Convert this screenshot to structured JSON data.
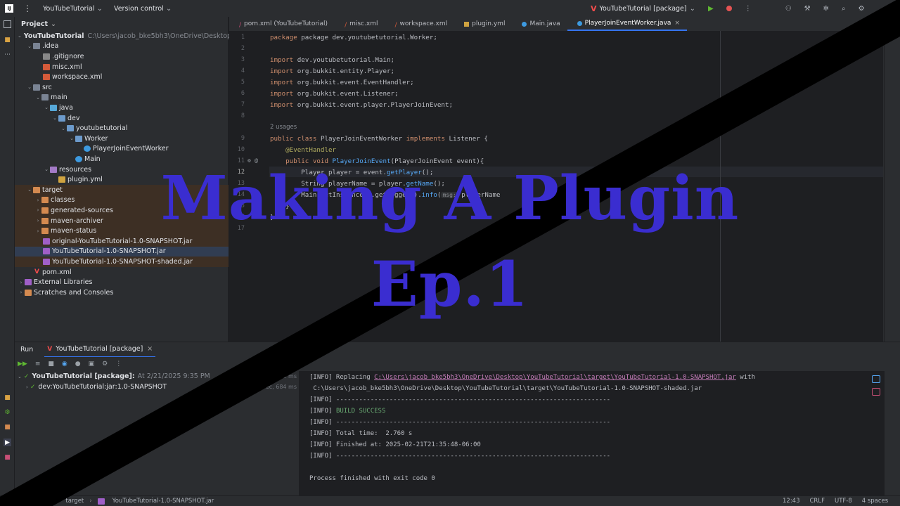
{
  "titlebar": {
    "project": "YouTubeTutorial",
    "version_control": "Version control",
    "run_config": "YouTubeTutorial [package]"
  },
  "project_panel": {
    "title": "Project"
  },
  "tree": [
    {
      "label": "YouTubeTutorial",
      "path": "C:\\Users\\jacob_bke5bh3\\OneDrive\\Desktop\\YouTubeTutorial"
    },
    {
      "label": ".idea"
    },
    {
      "label": ".gitignore"
    },
    {
      "label": "misc.xml"
    },
    {
      "label": "workspace.xml"
    },
    {
      "label": "src"
    },
    {
      "label": "main"
    },
    {
      "label": "java"
    },
    {
      "label": "dev"
    },
    {
      "label": "youtubetutorial"
    },
    {
      "label": "Worker"
    },
    {
      "label": "PlayerJoinEventWorker"
    },
    {
      "label": "Main"
    },
    {
      "label": "resources"
    },
    {
      "label": "plugin.yml"
    },
    {
      "label": "target"
    },
    {
      "label": "classes"
    },
    {
      "label": "generated-sources"
    },
    {
      "label": "maven-archiver"
    },
    {
      "label": "maven-status"
    },
    {
      "label": "original-YouTubeTutorial-1.0-SNAPSHOT.jar"
    },
    {
      "label": "YouTubeTutorial-1.0-SNAPSHOT.jar"
    },
    {
      "label": "YouTubeTutorial-1.0-SNAPSHOT-shaded.jar"
    },
    {
      "label": "pom.xml"
    },
    {
      "label": "External Libraries"
    },
    {
      "label": "Scratches and Consoles"
    }
  ],
  "tabs": [
    {
      "label": "pom.xml (YouTubeTutorial)"
    },
    {
      "label": "misc.xml"
    },
    {
      "label": "workspace.xml"
    },
    {
      "label": "plugin.yml"
    },
    {
      "label": "Main.java"
    },
    {
      "label": "PlayerJoinEventWorker.java"
    }
  ],
  "code": {
    "line_numbers": [
      "1",
      "2",
      "3",
      "4",
      "5",
      "6",
      "7",
      "8",
      "",
      "9",
      "10",
      "11",
      "12",
      "13",
      "14",
      "15",
      "16",
      "17"
    ],
    "l1": "package dev.youtubetutorial.Worker;",
    "imp": [
      "dev.youtubetutorial.Main;",
      "org.bukkit.entity.Player;",
      "org.bukkit.event.EventHandler;",
      "org.bukkit.event.Listener;",
      "org.bukkit.event.player.PlayerJoinEvent;"
    ],
    "import_kw": "import",
    "usages": "2 usages",
    "class_kw": "public class",
    "class_name": "PlayerJoinEventWorker",
    "implements_kw": "implements",
    "iface": "Listener {",
    "annotation": "@EventHandler",
    "method_kw": "public void",
    "method_name": "PlayerJoinEvent",
    "method_params": "(PlayerJoinEvent event){",
    "l12a": "Player player = event.",
    "l12b": "getPlayer",
    "l12c": "();",
    "l13a": "String playerName = player.",
    "l13b": "getName",
    "l13c": "();",
    "l14a": "Main.getInstance().getLogger().",
    "l14b": "info",
    "l14c": "(",
    "l14hint": "msg:",
    "l14d": " playerName",
    "l15": "}",
    "l16": "}"
  },
  "run": {
    "tab_run": "Run",
    "tab_config": "YouTubeTutorial [package]",
    "tree": [
      {
        "label": "YouTubeTutorial [package]:",
        "meta": "At 2/21/2025 9:35 PM",
        "time": "75 ms"
      },
      {
        "label": "dev:YouTubeTutorial:jar:1.0-SNAPSHOT",
        "time": "2 sec, 684 ms"
      }
    ]
  },
  "console": {
    "replacing_prefix": "[INFO] Replacing ",
    "replacing_link": "C:\\Users\\jacob_bke5bh3\\OneDrive\\Desktop\\YouTubeTutorial\\target\\YouTubeTutorial-1.0-SNAPSHOT.jar",
    "replacing_suffix": " with",
    "line2": " C:\\Users\\jacob_bke5bh3\\OneDrive\\Desktop\\YouTubeTutorial\\target\\YouTubeTutorial-1.0-SNAPSHOT-shaded.jar",
    "sep": "[INFO] ------------------------------------------------------------------------",
    "success_prefix": "[INFO] ",
    "success": "BUILD SUCCESS",
    "total": "[INFO] Total time:  2.760 s",
    "finished": "[INFO] Finished at: 2025-02-21T21:35:48-06:00",
    "exit": "Process finished with exit code 0"
  },
  "status": {
    "crumbs": [
      "target",
      "YouTubeTutorial-1.0-SNAPSHOT.jar"
    ],
    "position": "12:43",
    "line_sep": "CRLF",
    "encoding": "UTF-8",
    "indent": "4 spaces"
  },
  "overlay": {
    "line1": "Making A Plugin",
    "line2": "Ep.1"
  }
}
